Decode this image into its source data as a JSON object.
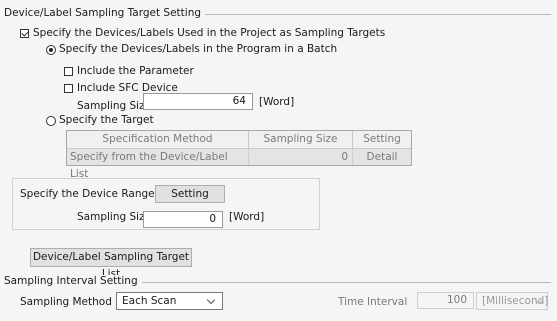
{
  "target_group": {
    "title": "Device/Label Sampling Target Setting",
    "specify_devices_checkbox": {
      "label": "Specify the Devices/Labels Used in the Project as Sampling Targets",
      "checked": true
    },
    "batch_radio": {
      "label": "Specify the Devices/Labels in the Program in a Batch",
      "selected": true
    },
    "include_parameter": {
      "label": "Include the Parameter",
      "checked": false
    },
    "include_sfc": {
      "label": "Include SFC Device",
      "checked": false
    },
    "sampling_size": {
      "label": "Sampling Size",
      "value": "64",
      "unit": "[Word]"
    },
    "target_radio": {
      "label": "Specify the Target",
      "selected": false
    },
    "table": {
      "headers": [
        "Specification Method",
        "Sampling Size [Word]",
        "Setting"
      ],
      "rows": [
        {
          "method": "Specify from the Device/Label List",
          "size": "0",
          "setting": "Detail"
        }
      ]
    }
  },
  "device_range": {
    "label": "Specify the Device Range",
    "button": "Setting",
    "sampling_size_label": "Sampling Size",
    "sampling_size_value": "0",
    "unit": "[Word]"
  },
  "list_button": "Device/Label Sampling Target List",
  "interval_group": {
    "title": "Sampling Interval Setting",
    "method_label": "Sampling Method",
    "method_value": "Each Scan",
    "time_label": "Time Interval",
    "time_value": "100",
    "time_unit": "[Millisecond]"
  }
}
